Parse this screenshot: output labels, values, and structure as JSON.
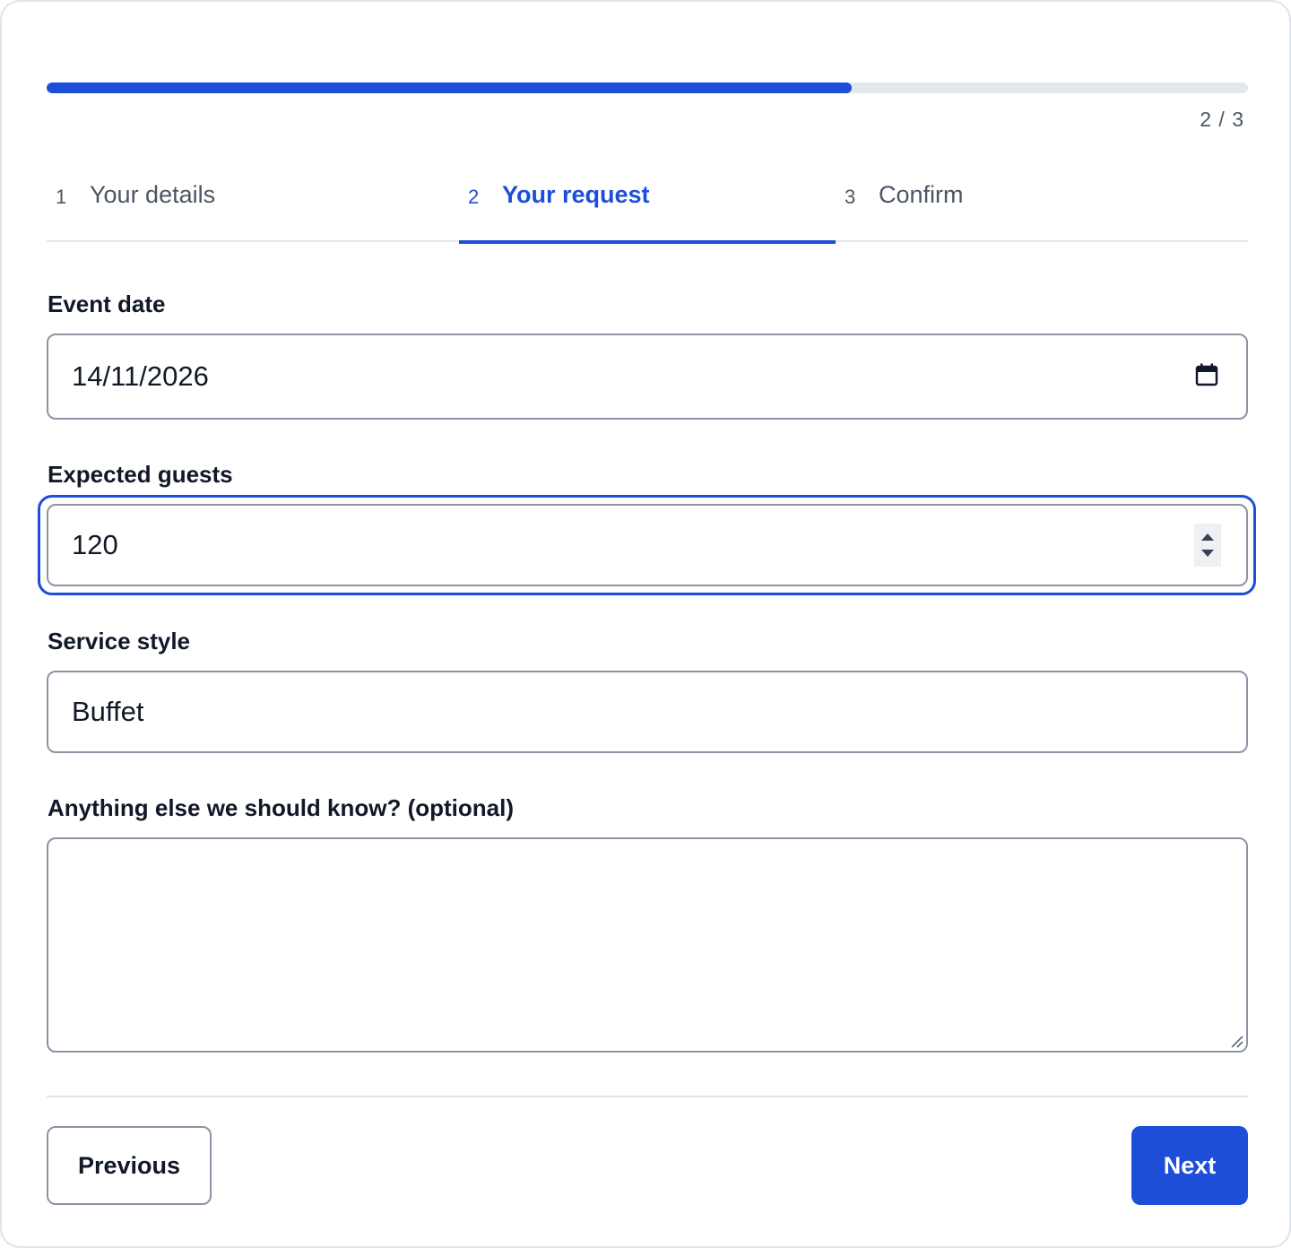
{
  "progress": {
    "value": 0.67,
    "counter": "2 / 3"
  },
  "steps": [
    {
      "number": "1",
      "label": "Your details",
      "active": false
    },
    {
      "number": "2",
      "label": "Your request",
      "active": true
    },
    {
      "number": "3",
      "label": "Confirm",
      "active": false
    }
  ],
  "fields": {
    "event_date": {
      "label": "Event date",
      "value": "14/11/2026"
    },
    "guests": {
      "label": "Expected guests",
      "value": "120"
    },
    "service_style": {
      "label": "Service style",
      "value": "Buffet"
    },
    "notes": {
      "label": "Anything else we should know? (optional)",
      "value": ""
    }
  },
  "buttons": {
    "previous": "Previous",
    "next": "Next"
  },
  "colors": {
    "accent": "#1d4ed8",
    "border": "#8b94a3",
    "muted_text": "#4b5563"
  },
  "icons": {
    "date_picker": "calendar-icon",
    "stepper": "spinner-arrows-icon",
    "resize": "resize-grip-icon"
  }
}
